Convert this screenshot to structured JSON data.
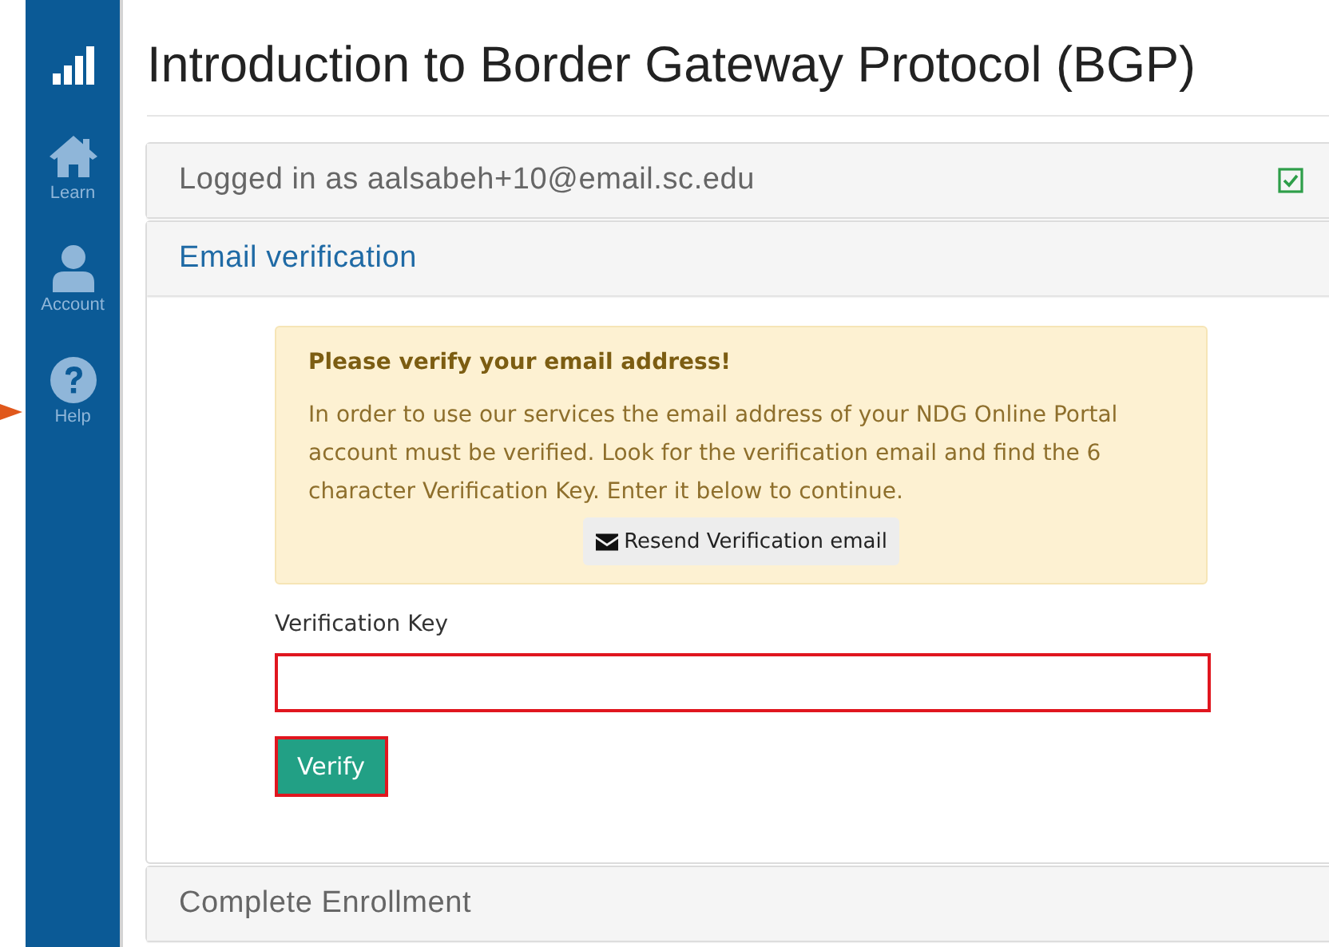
{
  "sidebar": {
    "items": [
      {
        "kind": "logo"
      },
      {
        "kind": "home",
        "label": "Learn"
      },
      {
        "kind": "user",
        "label": "Account"
      },
      {
        "kind": "help",
        "label": "Help"
      }
    ]
  },
  "annotation": {
    "kind": "arrow"
  },
  "page_title": "Introduction to Border Gateway Protocol (BGP)",
  "sections": [
    {
      "title": "Logged in as aalsabeh+10@email.sc.edu",
      "expanded": false,
      "checked": true
    },
    {
      "title": "Email verification",
      "expanded": true,
      "checked": false,
      "alert": {
        "heading": "Please verify your email address!",
        "text": "In order to use our services the email address of your NDG Online Portal account must be verified. Look for the verification email and find the 6 character Verification Key. Enter it below to continue.",
        "button": "Resend Verification email"
      },
      "field": {
        "label": "Verification Key",
        "highlighted": true
      },
      "submit": {
        "label": "Verify",
        "highlighted": true
      }
    },
    {
      "title": "Complete Enrollment",
      "expanded": false,
      "checked": false
    }
  ]
}
